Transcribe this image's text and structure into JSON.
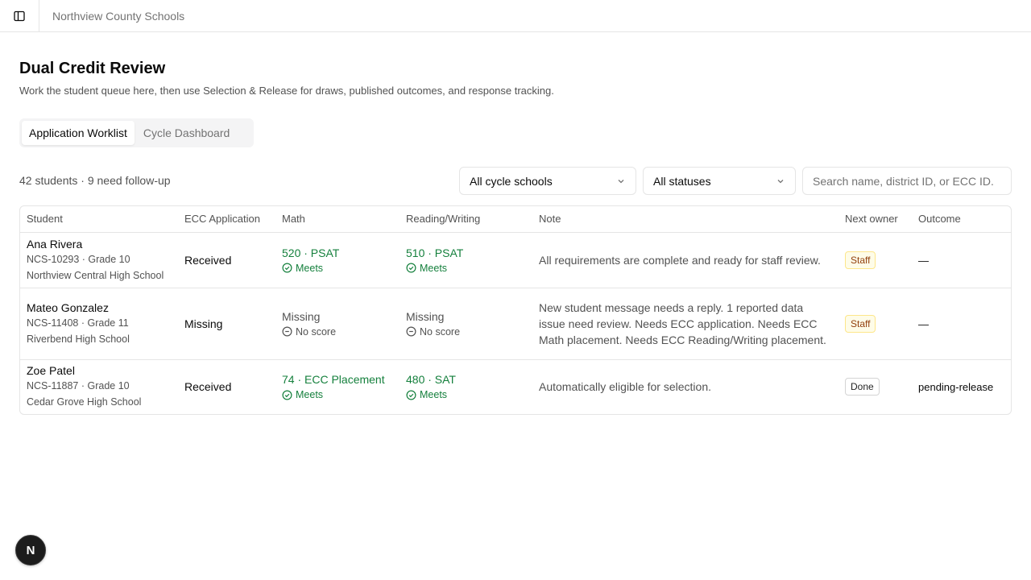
{
  "topbar": {
    "org_name": "Northview County Schools",
    "toggle_icon": "sidebar-toggle-icon"
  },
  "page": {
    "title": "Dual Credit Review",
    "subtitle": "Work the student queue here, then use Selection & Release for draws, published outcomes, and response tracking."
  },
  "tabs": [
    {
      "label": "Application Worklist",
      "active": true
    },
    {
      "label": "Cycle Dashboard",
      "active": false
    }
  ],
  "summary": "42 students · 9 need follow-up",
  "filters": {
    "schools_label": "All cycle schools",
    "statuses_label": "All statuses",
    "search_placeholder": "Search name, district ID, or ECC ID."
  },
  "table": {
    "headers": [
      "Student",
      "ECC Application",
      "Math",
      "Reading/Writing",
      "Note",
      "Next owner",
      "Outcome"
    ],
    "rows": [
      {
        "name": "Ana Rivera",
        "ids": "NCS-10293 · Grade 10",
        "school": "Northview Central High School",
        "application": "Received",
        "math_value": "520 · PSAT",
        "math_status": "Meets",
        "rw_value": "510 · PSAT",
        "rw_status": "Meets",
        "note": "All requirements are complete and ready for staff review.",
        "owner": "Staff",
        "outcome": "—"
      },
      {
        "name": "Mateo Gonzalez",
        "ids": "NCS-11408 · Grade 11",
        "school": "Riverbend High School",
        "application": "Missing",
        "math_value": "Missing",
        "math_status": "No score",
        "rw_value": "Missing",
        "rw_status": "No score",
        "note": "New student message needs a reply. 1 reported data issue need review. Needs ECC application. Needs ECC Math placement. Needs ECC Reading/Writing placement.",
        "owner": "Staff",
        "outcome": "—"
      },
      {
        "name": "Zoe Patel",
        "ids": "NCS-11887 · Grade 10",
        "school": "Cedar Grove High School",
        "application": "Received",
        "math_value": "74 · ECC Placement",
        "math_status": "Meets",
        "rw_value": "480 · SAT",
        "rw_status": "Meets",
        "note": "Automatically eligible for selection.",
        "owner": "Done",
        "outcome": "pending-release"
      }
    ]
  },
  "fab": {
    "label": "N"
  },
  "colors": {
    "meets": "#15803d",
    "staff_badge_bg": "#fefce8",
    "staff_badge_text": "#92400e",
    "border": "#e5e5e5"
  }
}
